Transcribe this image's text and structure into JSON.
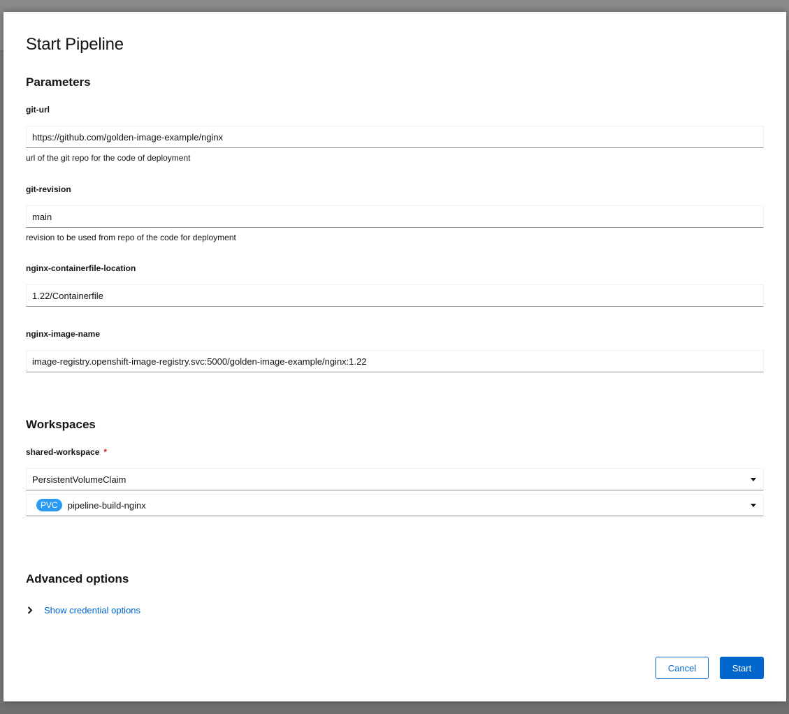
{
  "dialog": {
    "title": "Start Pipeline"
  },
  "parameters": {
    "heading": "Parameters",
    "fields": [
      {
        "label": "git-url",
        "value": "https://github.com/golden-image-example/nginx",
        "helper": "url of the git repo for the code of deployment"
      },
      {
        "label": "git-revision",
        "value": "main",
        "helper": "revision to be used from repo of the code for deployment"
      },
      {
        "label": "nginx-containerfile-location",
        "value": "1.22/Containerfile",
        "helper": ""
      },
      {
        "label": "nginx-image-name",
        "value": "image-registry.openshift-image-registry.svc:5000/golden-image-example/nginx:1.22",
        "helper": ""
      }
    ]
  },
  "workspaces": {
    "heading": "Workspaces",
    "shared": {
      "label": "shared-workspace",
      "required_mark": "*",
      "type_value": "PersistentVolumeClaim",
      "pvc_badge": "PVC",
      "pvc_value": "pipeline-build-nginx"
    }
  },
  "advanced": {
    "heading": "Advanced options",
    "toggle_label": "Show credential options"
  },
  "footer": {
    "cancel_label": "Cancel",
    "start_label": "Start"
  },
  "icons": {
    "caret": "caret-down-icon",
    "chevron": "chevron-right-icon"
  },
  "colors": {
    "primary": "#0066cc",
    "badge": "#2b9af3",
    "required": "#c9190b"
  }
}
